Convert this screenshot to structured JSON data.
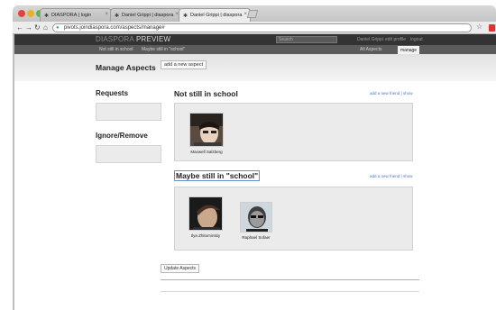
{
  "browser": {
    "tabs": [
      {
        "label": "DIASPORA | login",
        "active": false
      },
      {
        "label": "Daniel Grippi | diaspora",
        "active": false
      },
      {
        "label": "Daniel Grippi | diaspora",
        "active": true
      }
    ],
    "url": "pivots.joindiaspora.com/aspects/manage#",
    "icons": [
      "back-icon",
      "forward-icon",
      "reload-icon",
      "home-icon",
      "globe-icon",
      "star-icon",
      "pdf-icon",
      "wrench-icon"
    ],
    "traffic_colors": [
      "#e0453b",
      "#e9b12b",
      "#5ab745"
    ]
  },
  "header": {
    "brand_main": "DIASPORA",
    "brand_suffix": "PREVIEW",
    "search_placeholder": "Search",
    "links": [
      "Daniel Grippi",
      "edit profile",
      "logout"
    ]
  },
  "aspect_nav": {
    "left_tabs": [
      "Not still in school",
      "Maybe still in \"school\""
    ],
    "right_tabs": [
      "All Aspects",
      "manage"
    ],
    "selected": "manage"
  },
  "page": {
    "title": "Manage Aspects",
    "add_aspect_label": "add a new aspect"
  },
  "sidebar": {
    "requests_title": "Requests",
    "ignore_title": "Ignore/Remove"
  },
  "aspects": [
    {
      "title": "Not still in school",
      "actions": "add a new friend | show",
      "people": [
        {
          "name": "Maxwell Salzberg"
        }
      ]
    },
    {
      "title": "Maybe still in \"school\"",
      "actions": "add a new friend | show",
      "people": [
        {
          "name": "Ilya Zhitomirskiy"
        },
        {
          "name": "Raphael Sofaer"
        }
      ]
    }
  ],
  "update_label": "Update Aspects",
  "colors": {
    "header_bg": "#333333",
    "aspect_bar_bg": "#5b5b5b",
    "link": "#4a78b8",
    "box_bg": "#ebebeb"
  }
}
